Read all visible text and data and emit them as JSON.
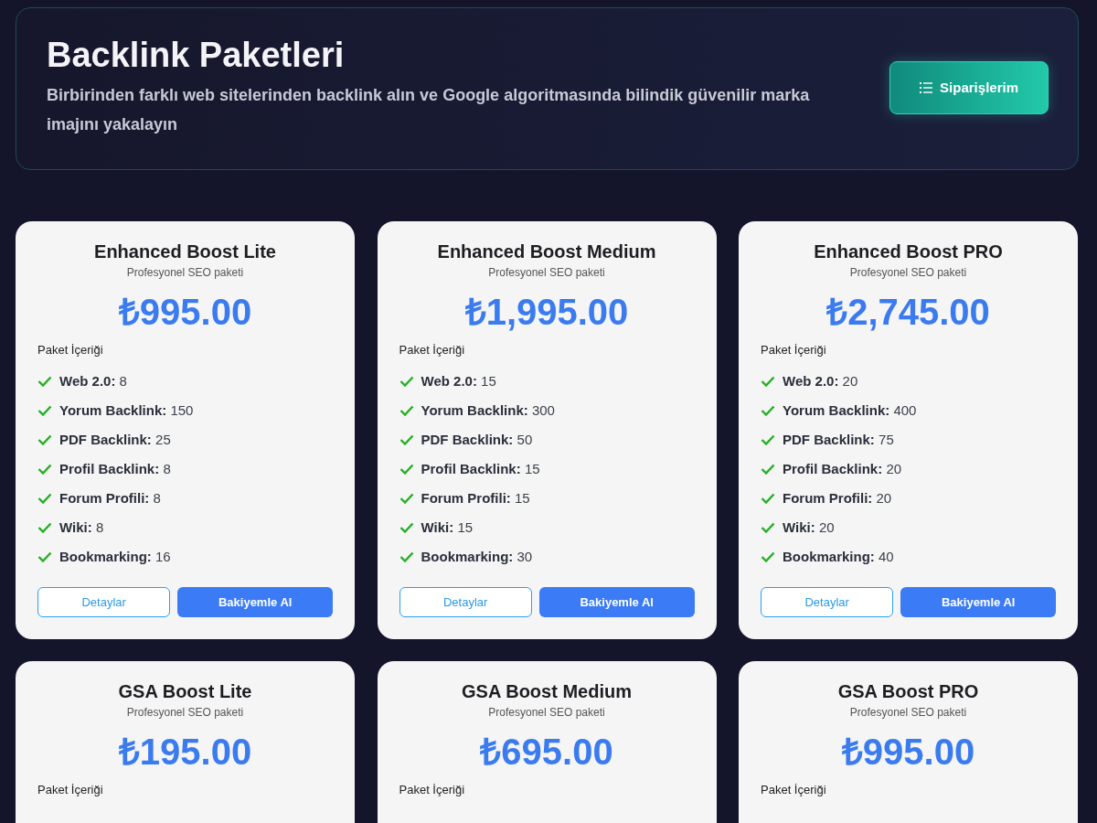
{
  "header": {
    "title": "Backlink Paketleri",
    "subtitle": "Birbirinden farklı web sitelerinden backlink alın ve Google algoritmasında bilindik güvenilir marka imajını yakalayın",
    "button": "Siparişlerim"
  },
  "packages": [
    {
      "name": "Enhanced Boost Lite",
      "tagline": "Profesyonel SEO paketi",
      "price": "₺995.00",
      "contents_label": "Paket İçeriği",
      "features": [
        {
          "label": "Web 2.0:",
          "value": "8"
        },
        {
          "label": "Yorum Backlink:",
          "value": "150"
        },
        {
          "label": "PDF Backlink:",
          "value": "25"
        },
        {
          "label": "Profil Backlink:",
          "value": "8"
        },
        {
          "label": "Forum Profili:",
          "value": "8"
        },
        {
          "label": "Wiki:",
          "value": "8"
        },
        {
          "label": "Bookmarking:",
          "value": "16"
        }
      ],
      "buttons": [
        "Detaylar",
        "Bakiyemle Al"
      ]
    },
    {
      "name": "Enhanced Boost Medium",
      "tagline": "Profesyonel SEO paketi",
      "price": "₺1,995.00",
      "contents_label": "Paket İçeriği",
      "features": [
        {
          "label": "Web 2.0:",
          "value": "15"
        },
        {
          "label": "Yorum Backlink:",
          "value": "300"
        },
        {
          "label": "PDF Backlink:",
          "value": "50"
        },
        {
          "label": "Profil Backlink:",
          "value": "15"
        },
        {
          "label": "Forum Profili:",
          "value": "15"
        },
        {
          "label": "Wiki:",
          "value": "15"
        },
        {
          "label": "Bookmarking:",
          "value": "30"
        }
      ],
      "buttons": [
        "Detaylar",
        "Bakiyemle Al"
      ]
    },
    {
      "name": "Enhanced Boost PRO",
      "tagline": "Profesyonel SEO paketi",
      "price": "₺2,745.00",
      "contents_label": "Paket İçeriği",
      "features": [
        {
          "label": "Web 2.0:",
          "value": "20"
        },
        {
          "label": "Yorum Backlink:",
          "value": "400"
        },
        {
          "label": "PDF Backlink:",
          "value": "75"
        },
        {
          "label": "Profil Backlink:",
          "value": "20"
        },
        {
          "label": "Forum Profili:",
          "value": "20"
        },
        {
          "label": "Wiki:",
          "value": "20"
        },
        {
          "label": "Bookmarking:",
          "value": "40"
        }
      ],
      "buttons": [
        "Detaylar",
        "Bakiyemle Al"
      ]
    },
    {
      "name": "GSA Boost Lite",
      "tagline": "Profesyonel SEO paketi",
      "price": "₺195.00",
      "contents_label": "Paket İçeriği"
    },
    {
      "name": "GSA Boost Medium",
      "tagline": "Profesyonel SEO paketi",
      "price": "₺695.00",
      "contents_label": "Paket İçeriği"
    },
    {
      "name": "GSA Boost PRO",
      "tagline": "Profesyonel SEO paketi",
      "price": "₺995.00",
      "contents_label": "Paket İçeriği"
    }
  ]
}
